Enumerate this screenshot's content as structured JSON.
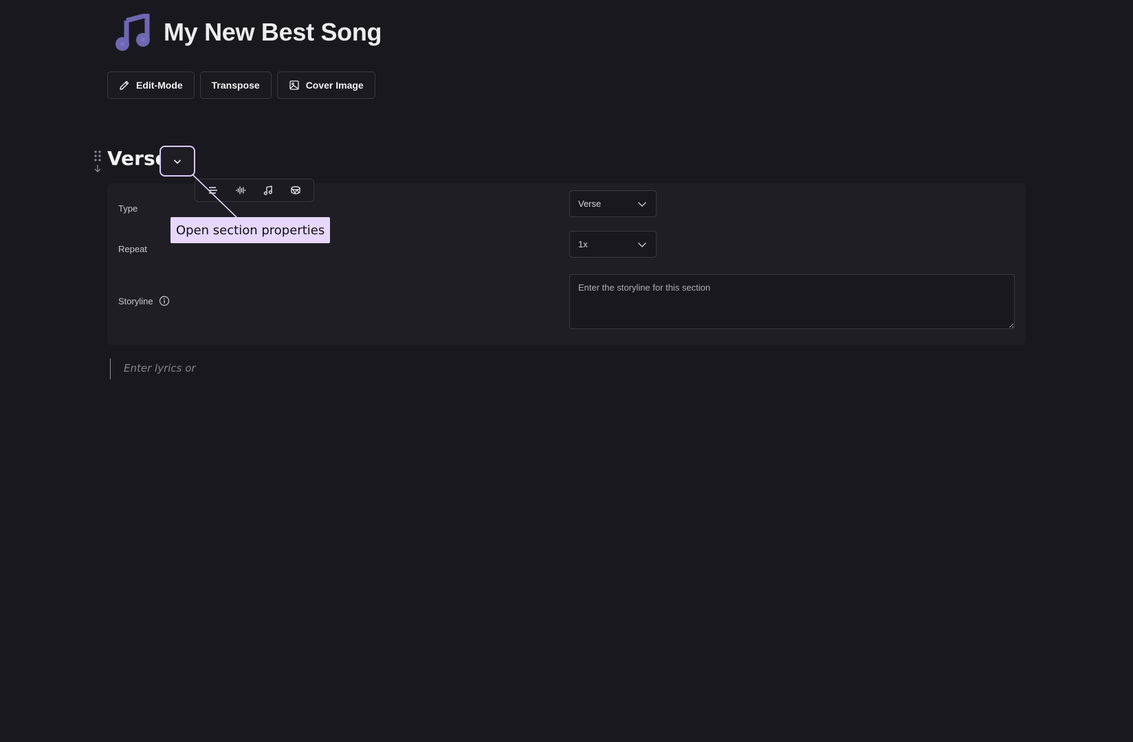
{
  "song": {
    "title": "My New Best Song",
    "icon": "music-note-icon",
    "icon_color": "#6f67b4"
  },
  "toolbar": {
    "edit_mode_label": "Edit-Mode",
    "transpose_label": "Transpose",
    "cover_image_label": "Cover Image"
  },
  "section": {
    "title": "Verse",
    "tools": [
      "align-lines-icon",
      "waveform-icon",
      "music-note-icon",
      "drum-icon"
    ],
    "tooltip": "Open section properties",
    "accent_color": "#d9c9f7",
    "properties": {
      "type_label": "Type",
      "type_value": "Verse",
      "repeat_label": "Repeat",
      "repeat_value": "1x",
      "storyline_label": "Storyline",
      "storyline_placeholder": "Enter the storyline for this section"
    },
    "lyrics_placeholder": "Enter lyrics or"
  }
}
